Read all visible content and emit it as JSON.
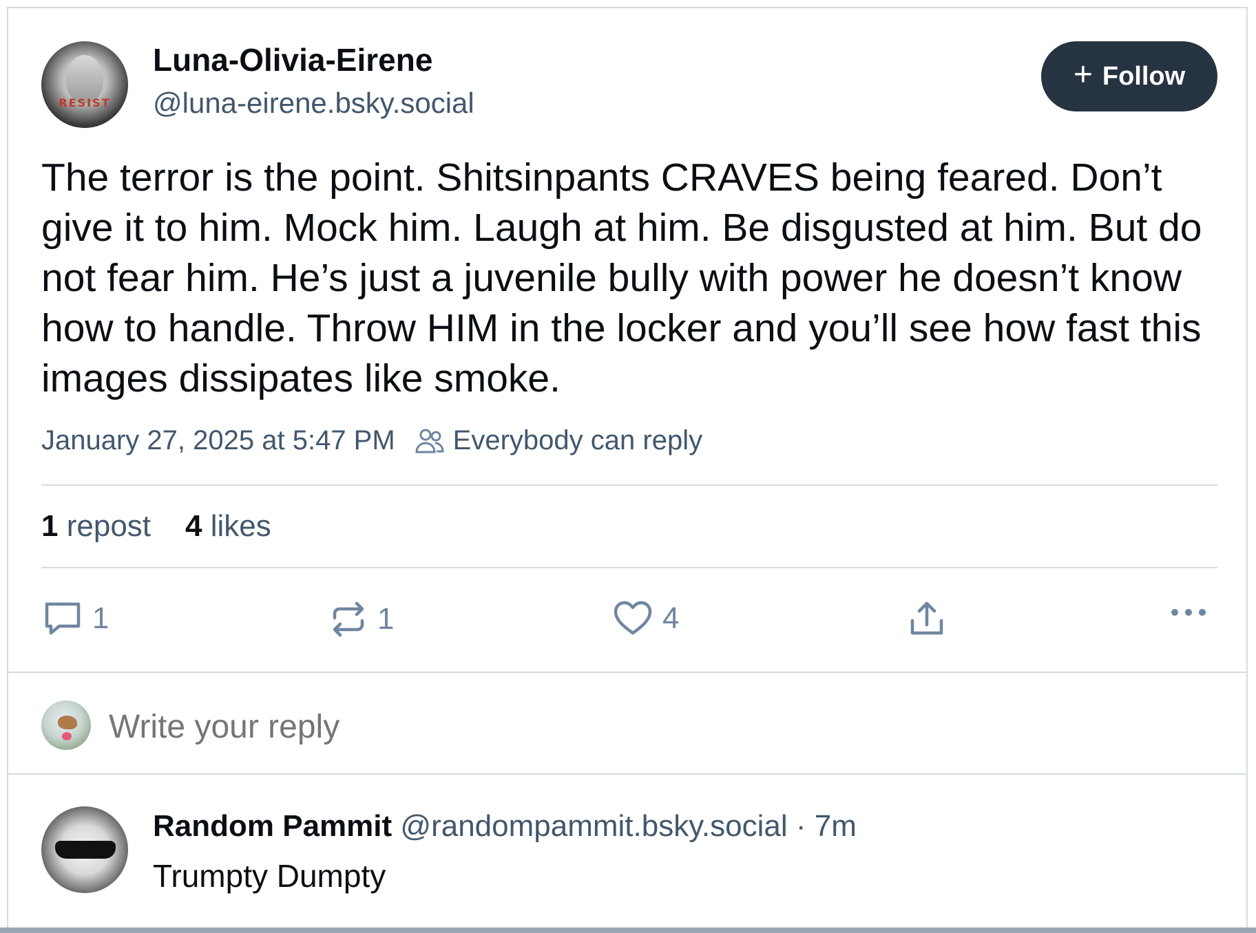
{
  "post": {
    "author": {
      "display_name": "Luna-Olivia-Eirene",
      "handle": "@luna-eirene.bsky.social",
      "avatar_badge_text": "RESIST"
    },
    "follow_label": "Follow",
    "text": "The terror is the point. Shitsinpants CRAVES being feared. Don’t give it to him. Mock him. Laugh at him. Be disgusted at him. But do not fear him. He’s just a juvenile bully with power he doesn’t know how to handle. Throw HIM in the locker and you’ll see how fast this images dissipates like smoke.",
    "timestamp": "January 27, 2025 at 5:47 PM",
    "reply_setting": "Everybody can reply",
    "stats": {
      "repost_count": "1",
      "repost_label": "repost",
      "like_count": "4",
      "like_label": "likes"
    },
    "actions": {
      "reply_count": "1",
      "repost_count": "1",
      "like_count": "4"
    }
  },
  "composer": {
    "placeholder": "Write your reply"
  },
  "replies": [
    {
      "display_name": "Random Pammit",
      "handle": "@randompammit.bsky.social",
      "separator": "·",
      "age": "7m",
      "text": "Trumpty Dumpty"
    }
  ],
  "colors": {
    "follow_button_bg": "#263340",
    "text_primary": "#0b0f14",
    "text_secondary": "#42576c",
    "icon_muted": "#6f869f",
    "divider": "#d4dbe2"
  }
}
